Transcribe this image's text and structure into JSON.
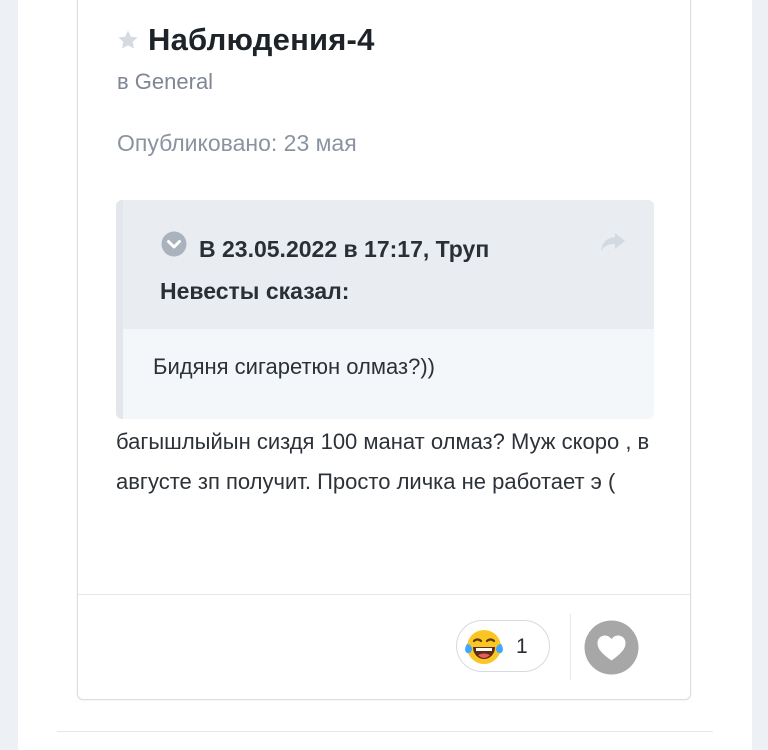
{
  "post": {
    "title": "Наблюдения-4",
    "category": "в General",
    "published": "Опубликовано: 23 мая",
    "body": "багышлыйын сиздя 100 манат олмаз? Муж скоро , в августе зп получит. Просто личка не работает э ("
  },
  "quote": {
    "citation": "В 23.05.2022 в 17:17, Труп Невесты сказал:",
    "text": "Бидяня сигаретюн олмаз?))"
  },
  "reactions": {
    "emoji_icon": "laughing-tears-icon",
    "count": "1",
    "like_icon": "heart-icon"
  },
  "colors": {
    "title": "#1e2329",
    "muted": "#8a94a1",
    "quote_header_bg": "#e9edf2",
    "quote_body_bg": "#f4f7fa"
  }
}
